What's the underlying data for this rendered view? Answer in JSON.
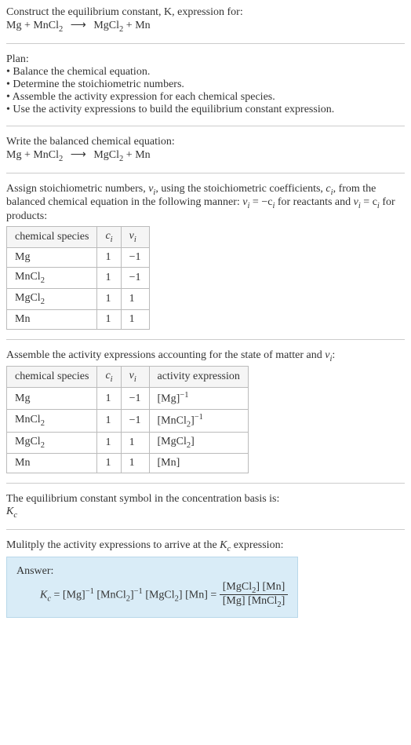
{
  "header": {
    "line1": "Construct the equilibrium constant, K, expression for:",
    "eq_lhs": "Mg + MnCl",
    "eq_lhs_sub": "2",
    "eq_arrow": "⟶",
    "eq_rhs1": "MgCl",
    "eq_rhs1_sub": "2",
    "eq_rhs2": " + Mn"
  },
  "plan": {
    "title": "Plan:",
    "b1": "• Balance the chemical equation.",
    "b2": "• Determine the stoichiometric numbers.",
    "b3": "• Assemble the activity expression for each chemical species.",
    "b4": "• Use the activity expressions to build the equilibrium constant expression."
  },
  "balanced": {
    "title": "Write the balanced chemical equation:",
    "eq_lhs": "Mg + MnCl",
    "eq_lhs_sub": "2",
    "eq_arrow": "⟶",
    "eq_rhs1": "MgCl",
    "eq_rhs1_sub": "2",
    "eq_rhs2": " + Mn"
  },
  "stoich": {
    "intro_a": "Assign stoichiometric numbers, ",
    "nu": "ν",
    "i": "i",
    "intro_b": ", using the stoichiometric coefficients, ",
    "c": "c",
    "intro_c": ", from the balanced chemical equation in the following manner: ",
    "rel1a": "ν",
    "rel1b": " = −c",
    "intro_d": " for reactants and ",
    "rel2a": "ν",
    "rel2b": " = c",
    "intro_e": " for products:",
    "th1": "chemical species",
    "th2": "c",
    "th3": "ν",
    "rows": [
      {
        "sp": "Mg",
        "c": "1",
        "v": "−1"
      },
      {
        "sp_a": "MnCl",
        "sp_sub": "2",
        "c": "1",
        "v": "−1"
      },
      {
        "sp_a": "MgCl",
        "sp_sub": "2",
        "c": "1",
        "v": "1"
      },
      {
        "sp": "Mn",
        "c": "1",
        "v": "1"
      }
    ]
  },
  "activity": {
    "intro_a": "Assemble the activity expressions accounting for the state of matter and ",
    "nu": "ν",
    "i": "i",
    "intro_b": ":",
    "th1": "chemical species",
    "th2": "c",
    "th3": "ν",
    "th4": "activity expression",
    "rows": [
      {
        "sp": "Mg",
        "c": "1",
        "v": "−1",
        "ae": "[Mg]",
        "ae_sup": "−1"
      },
      {
        "sp_a": "MnCl",
        "sp_sub": "2",
        "c": "1",
        "v": "−1",
        "ae_a": "[MnCl",
        "ae_sub": "2",
        "ae_b": "]",
        "ae_sup": "−1"
      },
      {
        "sp_a": "MgCl",
        "sp_sub": "2",
        "c": "1",
        "v": "1",
        "ae_a": "[MgCl",
        "ae_sub": "2",
        "ae_b": "]"
      },
      {
        "sp": "Mn",
        "c": "1",
        "v": "1",
        "ae": "[Mn]"
      }
    ]
  },
  "kc_symbol": {
    "line1": "The equilibrium constant symbol in the concentration basis is:",
    "K": "K",
    "csub": "c"
  },
  "multiply": {
    "line_a": "Mulitply the activity expressions to arrive at the ",
    "K": "K",
    "csub": "c",
    "line_b": " expression:"
  },
  "answer": {
    "label": "Answer:",
    "K": "K",
    "csub": "c",
    "eq": " = ",
    "t1": "[Mg]",
    "t1_sup": "−1",
    "sp": " ",
    "t2a": "[MnCl",
    "t2sub": "2",
    "t2b": "]",
    "t2_sup": "−1",
    "t3a": "[MgCl",
    "t3sub": "2",
    "t3b": "]",
    "t4": "[Mn]",
    "eq2": " = ",
    "num_a": "[MgCl",
    "num_sub": "2",
    "num_b": "] [Mn]",
    "den_a": "[Mg] [MnCl",
    "den_sub": "2",
    "den_b": "]"
  }
}
